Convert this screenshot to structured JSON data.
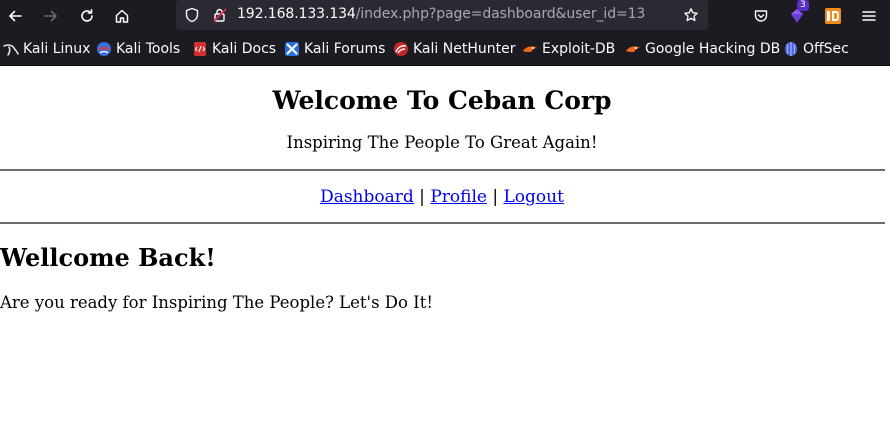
{
  "browser": {
    "url_host": "192.168.133.134",
    "url_path": "/index.php?page=dashboard&user_id=13",
    "extension_badge": "3",
    "bookmarks": [
      {
        "label": "Kali Linux",
        "icon": "kali-dragon-icon"
      },
      {
        "label": "Kali Tools",
        "icon": "kali-tools-icon"
      },
      {
        "label": "Kali Docs",
        "icon": "kali-docs-icon"
      },
      {
        "label": "Kali Forums",
        "icon": "kali-forums-icon"
      },
      {
        "label": "Kali NetHunter",
        "icon": "nethunter-icon"
      },
      {
        "label": "Exploit-DB",
        "icon": "exploit-db-icon"
      },
      {
        "label": "Google Hacking DB",
        "icon": "ghdb-icon"
      },
      {
        "label": "OffSec",
        "icon": "offsec-icon"
      }
    ],
    "colors": {
      "chrome": "#1c1b22",
      "urlbar": "#2b2a33",
      "text": "#fbfbfe",
      "muted": "#a8a8b3"
    }
  },
  "page": {
    "title": "Welcome To Ceban Corp",
    "subtitle": "Inspiring The People To Great Again!",
    "nav": {
      "dashboard": "Dashboard",
      "profile": "Profile",
      "logout": "Logout",
      "separator": "|"
    },
    "heading": "Wellcome Back!",
    "message": "Are you ready for Inspiring The People? Let's Do It!",
    "link_color": "#0000ee"
  }
}
